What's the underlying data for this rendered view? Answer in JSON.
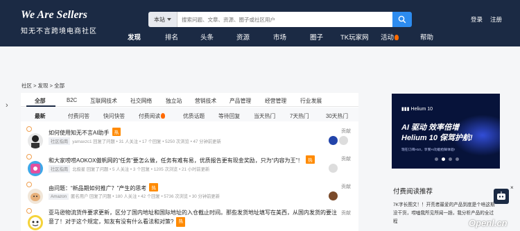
{
  "header": {
    "logo_title": "We Are Sellers",
    "logo_subtitle": "知无不言跨境电商社区",
    "search_scope": "本站",
    "search_placeholder": "搜索问题、文章、资源、圈子或社区用户",
    "login": "登录",
    "register": "注册"
  },
  "nav": [
    "发现",
    "排名",
    "头条",
    "资源",
    "市场",
    "圈子",
    "TK玩家网",
    "活动",
    "帮助"
  ],
  "breadcrumb": "社区 > 发现 > 全部",
  "category_tabs": [
    "全部",
    "B2C",
    "互联网技术",
    "社交网络",
    "独立站",
    "营销技术",
    "产品管理",
    "经营管理",
    "行业发展"
  ],
  "sub_tabs": [
    "最新",
    "付费问答",
    "快问快答",
    "付费阅读",
    "优质话题",
    "等待回复",
    "当天热门",
    "7天热门",
    "30天热门"
  ],
  "questions": [
    {
      "title": "如何使用知无不言AI助手",
      "hot": "热",
      "tag": "社区指南",
      "meta": "yamaxzc1 回复了问题 • 31 人关注 • 17 个回复 • 5250 次浏览 • 47 分钟前更新",
      "contrib": "贡献"
    },
    {
      "title": "和大家唠唠AOKOX傲帆网的“任务”要怎么做，任务有难有易，优质报告更有现金奖励，只为“内容为王”！",
      "hot": "热",
      "tag": "社区指南",
      "meta": "北极星 回复了问题 • 5 人关注 • 3 个回复 • 1205 次浏览 • 21 小时前更新",
      "contrib": "贡献"
    },
    {
      "title": "由问题：“新品期如何推广？”产生的思考",
      "hot": "热",
      "tag": "Amazon",
      "meta": "匿名用户 回复了问题 • 180 人关注 • 42 个回复 • 5736 次浏览 • 30 分钟前更新",
      "contrib": "贡献"
    },
    {
      "title": "亚马逊物流货件要求更新，区分了国内地址和国际地址的入仓截止时间。那些发货地址填写在美西，从国内发货的要注意了！对于这个规定，知友有没有什么看法和对策?",
      "hot": "热",
      "contrib": "贡献"
    }
  ],
  "ad": {
    "brand": "Helium 10",
    "headline1": "AI 驱动 效率倍增",
    "headline2": "Helium 10 保驾护航!",
    "small_text": "现在订阅H10，享受AI功能抢鲜体验!"
  },
  "reading": {
    "title": "付费阅读推荐",
    "body": "7K字长图文！！开荒者最爱的产品到底是个啥这期没干货，唠嗑我所见所闻一趟，我分析产品的全过程"
  },
  "float_close": "×",
  "watermark": "Openl.cn",
  "colors": {
    "header_bg": "#1b2a44",
    "accent": "#2d8cf0",
    "hot": "#ff8a00"
  }
}
